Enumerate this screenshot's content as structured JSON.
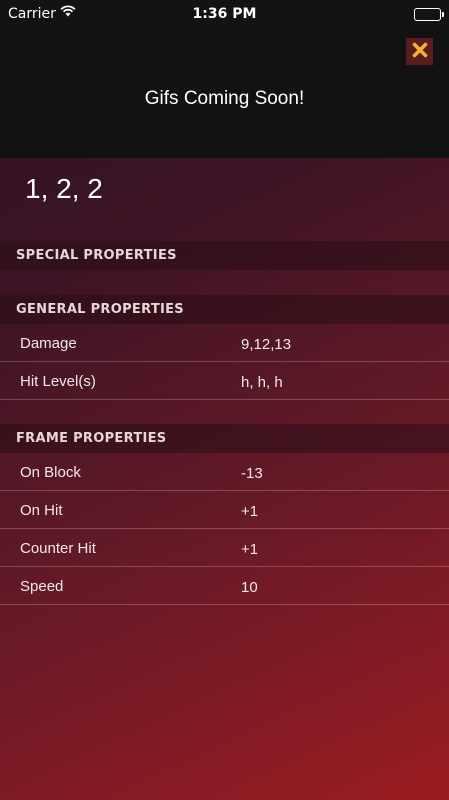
{
  "status_bar": {
    "carrier": "Carrier",
    "time": "1:36 PM"
  },
  "header": {
    "notice": "Gifs Coming Soon!",
    "close_icon": "close-x-icon"
  },
  "move": {
    "title": "1, 2, 2"
  },
  "sections": {
    "special": {
      "title": "SPECIAL PROPERTIES"
    },
    "general": {
      "title": "GENERAL PROPERTIES",
      "rows": [
        {
          "label": "Damage",
          "value": "9,12,13"
        },
        {
          "label": "Hit Level(s)",
          "value": "h, h, h"
        }
      ]
    },
    "frame": {
      "title": "FRAME PROPERTIES",
      "rows": [
        {
          "label": "On Block",
          "value": "-13"
        },
        {
          "label": "On Hit",
          "value": "+1"
        },
        {
          "label": "Counter Hit",
          "value": "+1"
        },
        {
          "label": "Speed",
          "value": "10"
        }
      ]
    }
  },
  "colors": {
    "close_button_bg": "#5a1c1c",
    "close_icon": "#f2b233",
    "gradient_dark": "#2a1220",
    "gradient_red": "#9b1c22"
  }
}
